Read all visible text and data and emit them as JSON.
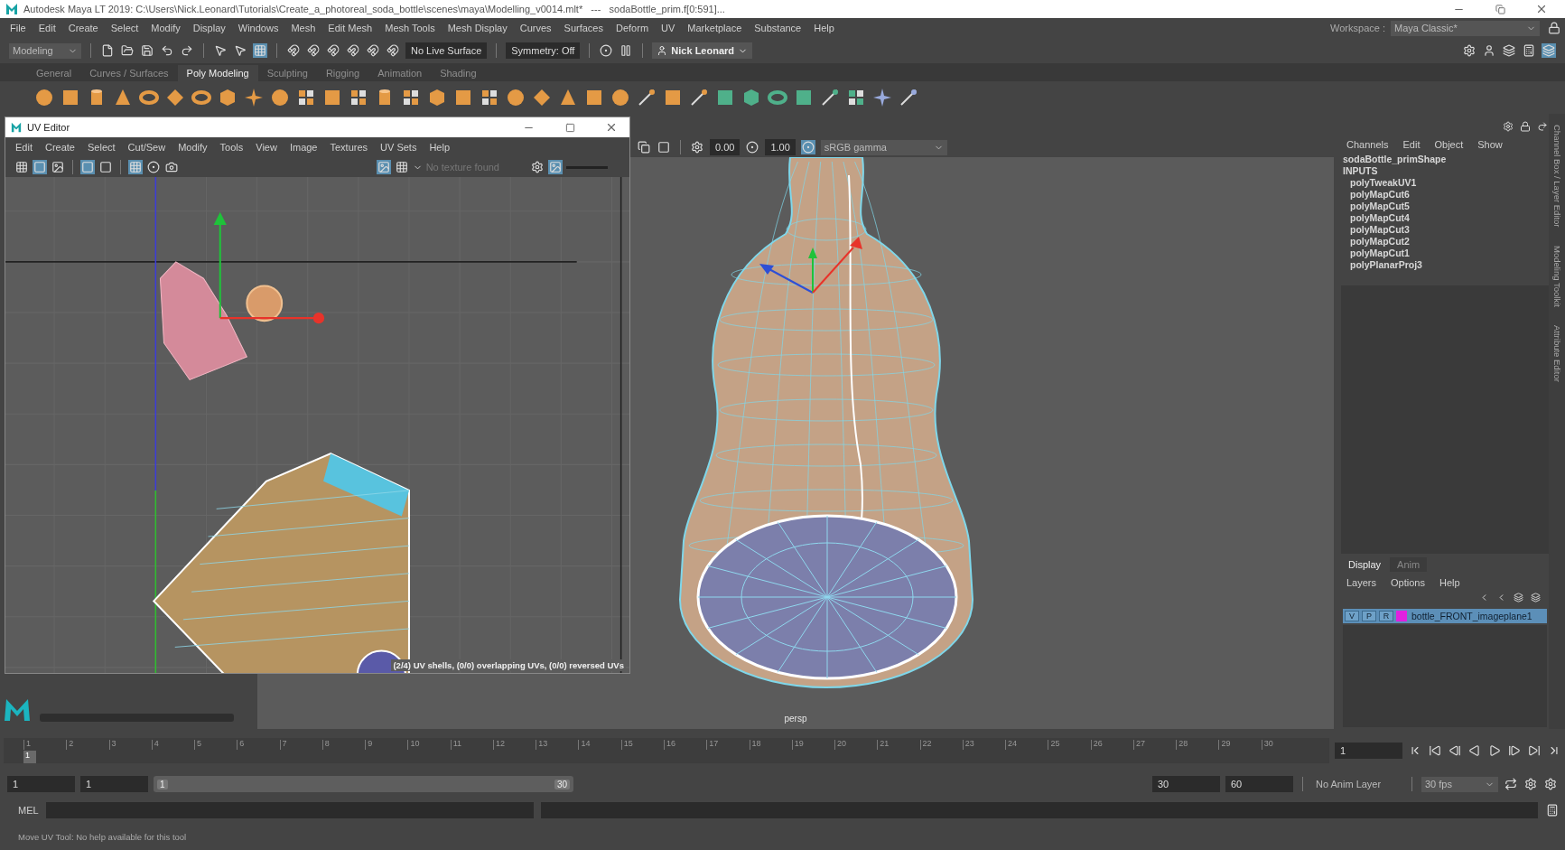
{
  "window": {
    "title": "Autodesk Maya LT 2019: C:\\Users\\Nick.Leonard\\Tutorials\\Create_a_photoreal_soda_bottle\\scenes\\maya\\Modelling_v0014.mlt*   ---   sodaBottle_prim.f[0:591]..."
  },
  "menu": [
    "File",
    "Edit",
    "Create",
    "Select",
    "Modify",
    "Display",
    "Windows",
    "Mesh",
    "Edit Mesh",
    "Mesh Tools",
    "Mesh Display",
    "Curves",
    "Surfaces",
    "Deform",
    "UV",
    "Marketplace",
    "Substance",
    "Help"
  ],
  "status_line": {
    "mode": "Modeling",
    "live_surface": "No Live Surface",
    "symmetry": "Symmetry: Off",
    "user": "Nick Leonard",
    "workspace_label": "Workspace :",
    "workspace": "Maya Classic*"
  },
  "shelf": {
    "tabs": [
      {
        "label": "General",
        "selected": false
      },
      {
        "label": "Curves / Surfaces",
        "selected": false
      },
      {
        "label": "Poly Modeling",
        "selected": true
      },
      {
        "label": "Sculpting",
        "selected": false
      },
      {
        "label": "Rigging",
        "selected": false
      },
      {
        "label": "Animation",
        "selected": false
      },
      {
        "label": "Shading",
        "selected": false
      }
    ]
  },
  "uv_editor": {
    "title": "UV Editor",
    "menu": [
      "Edit",
      "Create",
      "Select",
      "Cut/Sew",
      "Modify",
      "Tools",
      "View",
      "Image",
      "Textures",
      "UV Sets",
      "Help"
    ],
    "texture": "No texture found",
    "status": "(2/4) UV shells, (0/0) overlapping UVs, (0/0) reversed UVs"
  },
  "viewport": {
    "exposure": "0.00",
    "gamma": "1.00",
    "color_space": "sRGB gamma",
    "camera": "persp"
  },
  "channel_box": {
    "tabs": [
      "Channels",
      "Edit",
      "Object",
      "Show"
    ],
    "object": "sodaBottle_primShape",
    "section": "INPUTS",
    "inputs": [
      "polyTweakUV1",
      "polyMapCut6",
      "polyMapCut5",
      "polyMapCut4",
      "polyMapCut3",
      "polyMapCut2",
      "polyMapCut1",
      "polyPlanarProj3"
    ]
  },
  "layer_editor": {
    "tabs": [
      {
        "label": "Display",
        "selected": true
      },
      {
        "label": "Anim",
        "selected": false
      }
    ],
    "menu": [
      "Layers",
      "Options",
      "Help"
    ],
    "layers": [
      {
        "toggles": [
          "V",
          "P",
          "R"
        ],
        "color": "#e020e0",
        "name": "bottle_FRONT_imageplane1",
        "selected": true
      }
    ]
  },
  "side_tabs": [
    "Channel Box / Layer Editor",
    "Modeling Toolkit",
    "Attribute Editor"
  ],
  "timeline": {
    "ticks": [
      "1",
      "2",
      "3",
      "4",
      "5",
      "6",
      "7",
      "8",
      "9",
      "10",
      "11",
      "12",
      "13",
      "14",
      "15",
      "16",
      "17",
      "18",
      "19",
      "20",
      "21",
      "22",
      "23",
      "24",
      "25",
      "26",
      "27",
      "28",
      "29",
      "30"
    ],
    "current": "1",
    "frame_field": "1"
  },
  "range": {
    "start": "1",
    "playback_start": "1",
    "slider_start": "1",
    "slider_end": "30",
    "playback_end": "30",
    "end": "60",
    "anim_layer": "No Anim Layer",
    "fps": "30 fps"
  },
  "command_line": {
    "label": "MEL"
  },
  "help_line": "Move UV Tool: No help available for this tool"
}
